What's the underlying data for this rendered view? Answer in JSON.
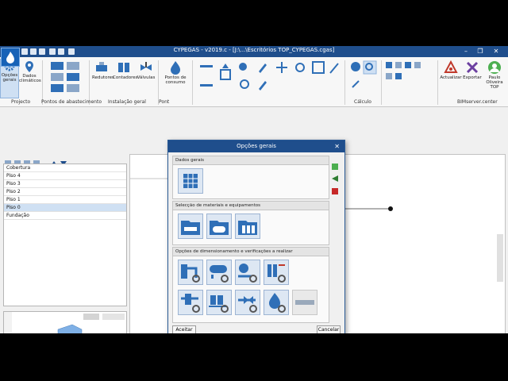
{
  "window": {
    "title": "CYPEGAS - v2019.c - [J:\\...\\Escritórios TOP_CYPEGAS.cgas]"
  },
  "ribbon": {
    "buttons": [
      {
        "label1": "Opções",
        "label2": "gerais"
      },
      {
        "label1": "Dados",
        "label2": "climáticos"
      },
      {
        "label1": "Redutores",
        "label2": ""
      },
      {
        "label1": "Contadores",
        "label2": ""
      },
      {
        "label1": "Válvulas",
        "label2": ""
      },
      {
        "label1": "Pontos de",
        "label2": "consumo"
      },
      {
        "label1": "Actualizar",
        "label2": ""
      },
      {
        "label1": "Exportar",
        "label2": ""
      },
      {
        "label1": "Paulo",
        "label2": "Oliveira TOP"
      }
    ],
    "groups": [
      "Projecto",
      "Pontos de abastecimento",
      "Instalação geral",
      "Pont",
      "Cálculo",
      "BIMserver.center"
    ]
  },
  "levels": [
    "Cobertura",
    "Piso 4",
    "Piso 3",
    "Piso 2",
    "Piso 1",
    "Piso 0",
    "Fundação"
  ],
  "selected_level": "Piso 0",
  "dialog": {
    "title": "Opções gerais",
    "sections": [
      "Dados gerais",
      "Selecção de materiais e equipamentos",
      "Opções de dimensionamento e verificações a realizar"
    ],
    "accept": "Aceitar",
    "cancel": "Cancelar"
  },
  "colors": {
    "titlebar": "#1f4e8c",
    "accent": "#2f6fb7"
  }
}
